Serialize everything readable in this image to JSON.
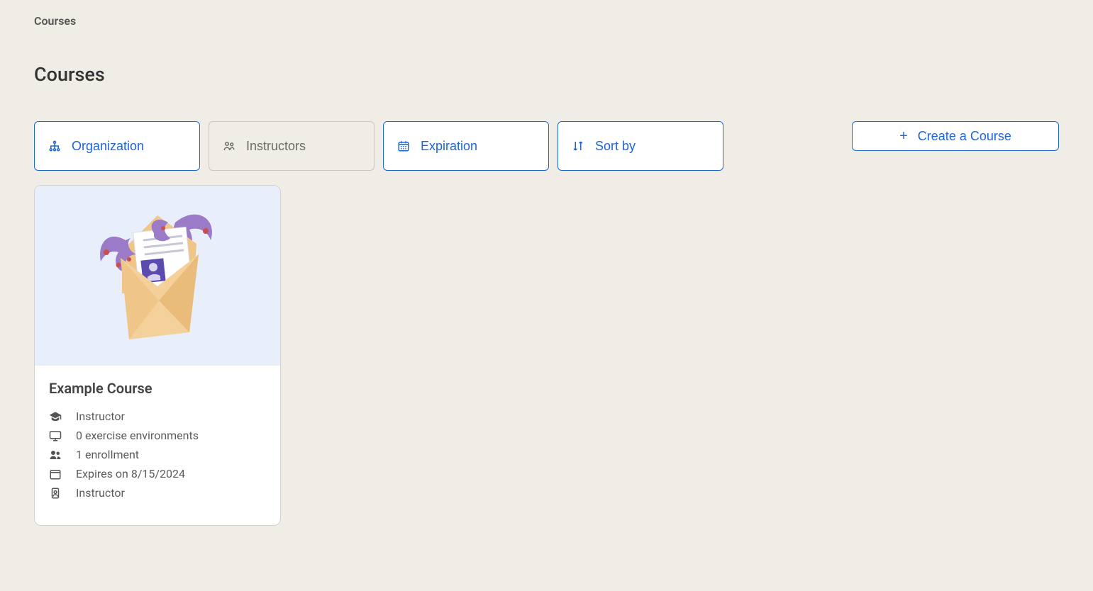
{
  "breadcrumb": "Courses",
  "title": "Courses",
  "filters": {
    "organization": "Organization",
    "instructors": "Instructors",
    "expiration": "Expiration",
    "sortby": "Sort by"
  },
  "create_label": "Create a Course",
  "course": {
    "title": "Example Course",
    "role": "Instructor",
    "environments": "0 exercise environments",
    "enrollment": "1 enrollment",
    "expires": "Expires on 8/15/2024",
    "owner_role": "Instructor"
  }
}
